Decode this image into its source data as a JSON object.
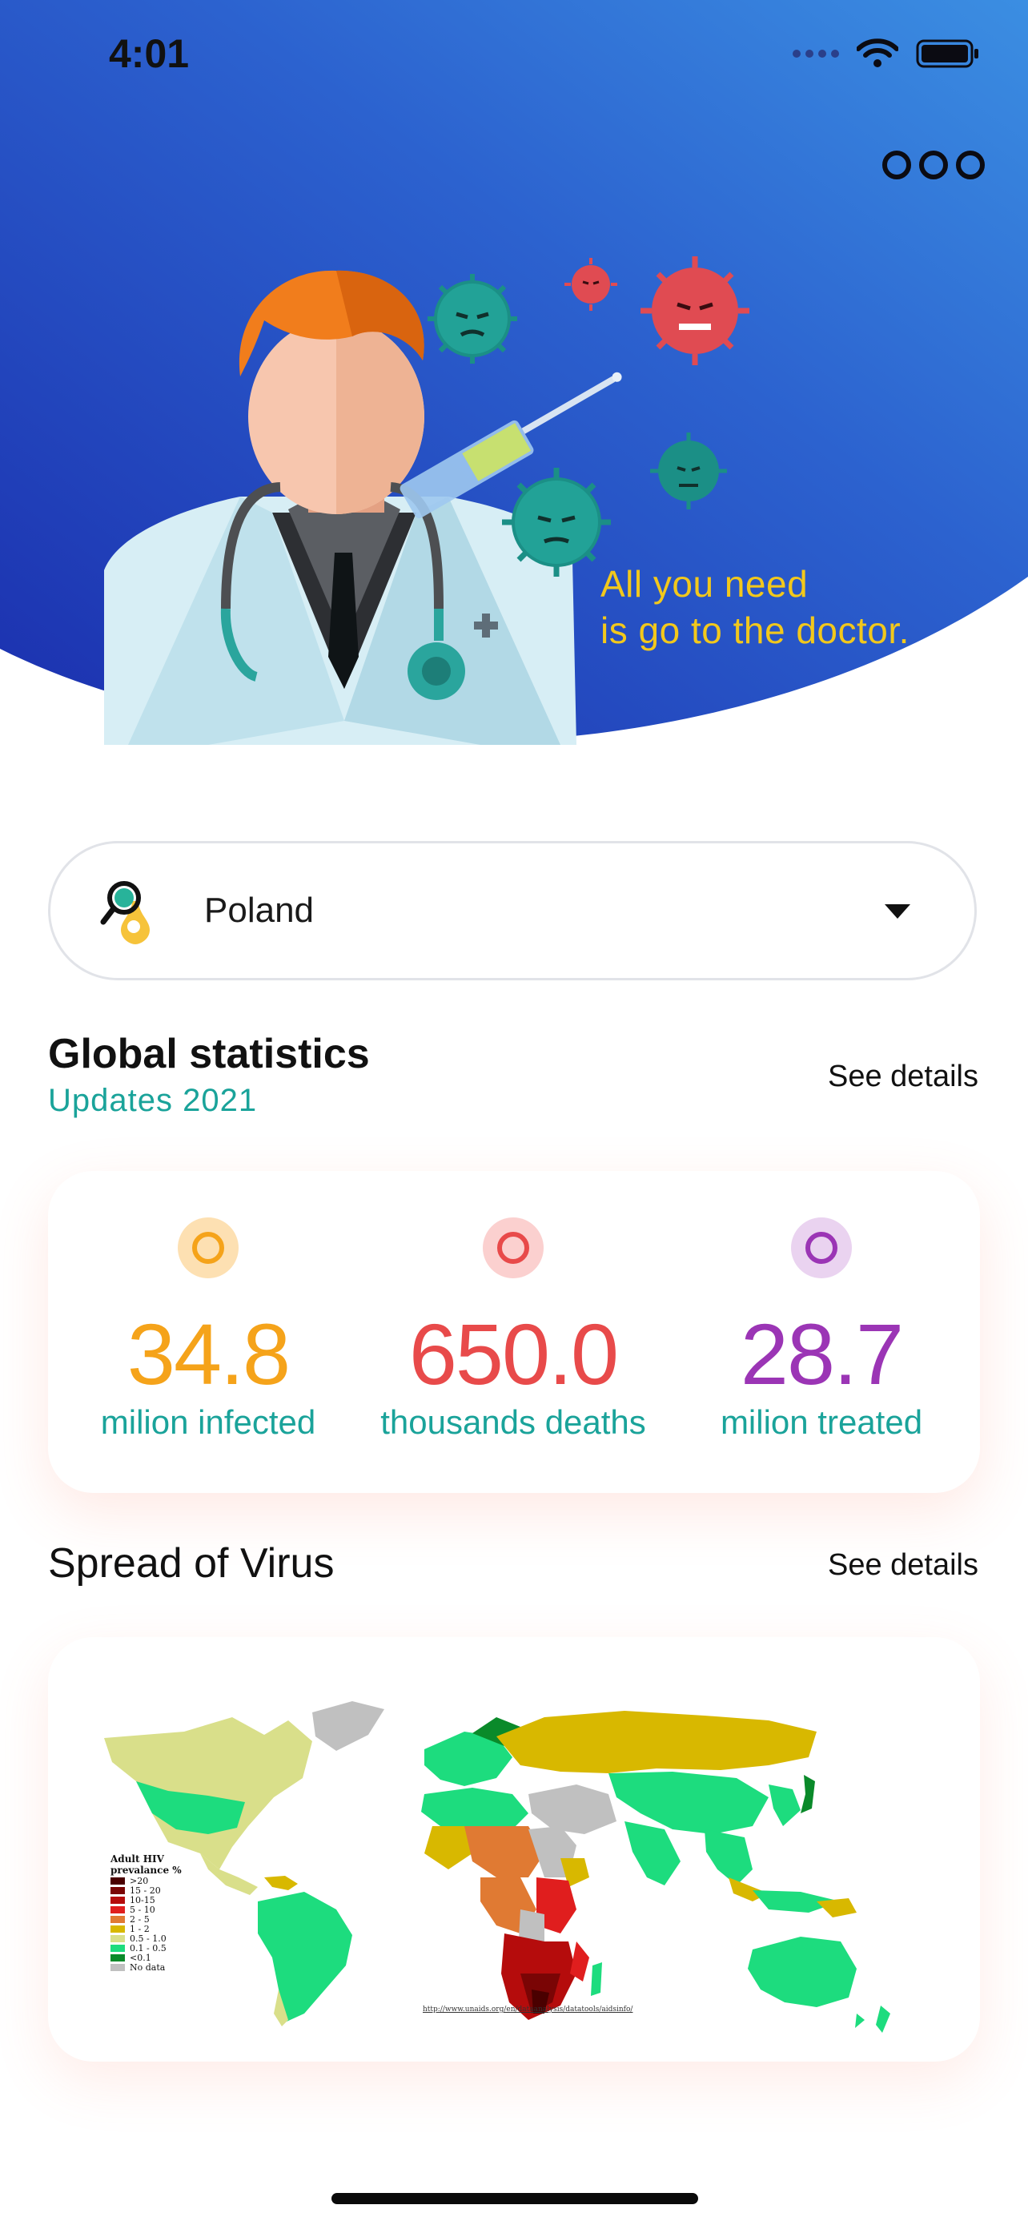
{
  "status_bar": {
    "time": "4:01"
  },
  "hero": {
    "tagline_line1": "All you need",
    "tagline_line2": "is go to the doctor.",
    "menu_icon": "more-dots-icon",
    "colors": {
      "gradient_start": "#1f35b8",
      "gradient_end": "#3a8be0",
      "tagline": "#f2c81c"
    }
  },
  "country_select": {
    "value": "Poland",
    "icon": "location-search-icon"
  },
  "global_statistics": {
    "title": "Global statistics",
    "subtitle": "Updates 2021",
    "see_details": "See details",
    "stats": [
      {
        "value": "34.8",
        "label": "milion infected",
        "color": "#f5a31a"
      },
      {
        "value": "650.0",
        "label": "thousands deaths",
        "color": "#e84a4a"
      },
      {
        "value": "28.7",
        "label": "milion treated",
        "color": "#9b35b5"
      }
    ]
  },
  "spread": {
    "title": "Spread of Virus",
    "see_details": "See details",
    "map_legend": {
      "title_line1": "Adult HIV",
      "title_line2": "prevalance %",
      "entries": [
        ">20",
        "15 - 20",
        "10-15",
        "5 - 10",
        "2 - 5",
        "1 - 2",
        "0.5 - 1.0",
        "0.1 - 0.5",
        "<0.1",
        "No data"
      ],
      "colors": [
        "#4a0000",
        "#7a0505",
        "#b50c0c",
        "#e01e1e",
        "#e07a33",
        "#d8b800",
        "#d9df8a",
        "#1ddc7e",
        "#0a8a2a",
        "#c0c0c0"
      ]
    },
    "map_source": "http://www.unaids.org/en/dataanalysis/datatools/aidsinfo/"
  }
}
